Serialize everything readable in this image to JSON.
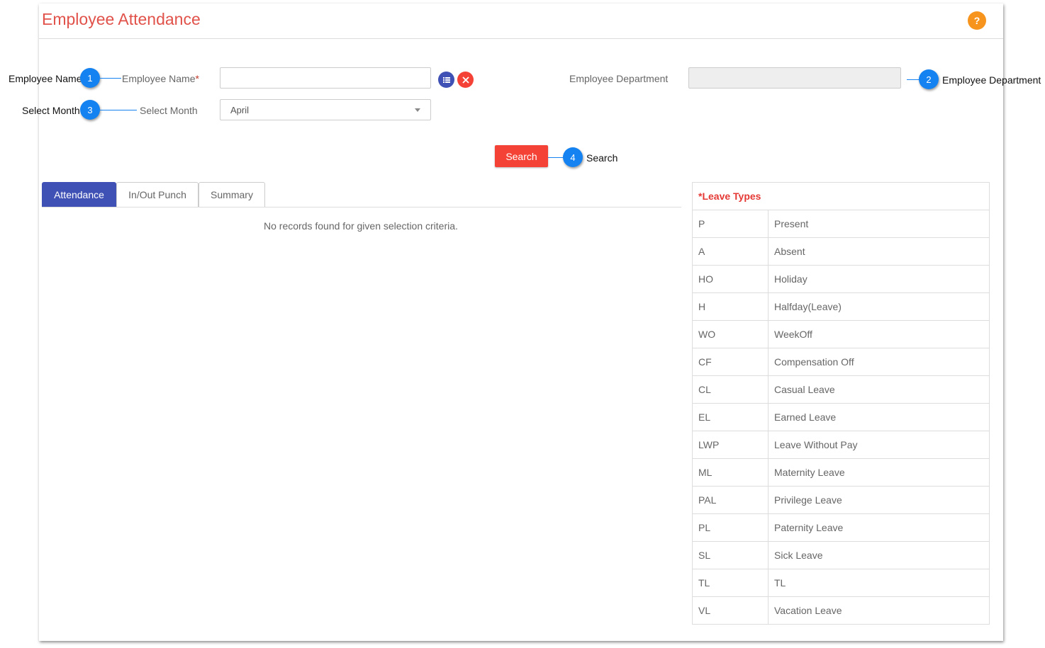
{
  "header": {
    "title": "Employee Attendance",
    "help_label": "?"
  },
  "form": {
    "employee_name_label": "Employee Name",
    "employee_name_required": "*",
    "employee_name_value": "",
    "employee_department_label": "Employee Department",
    "employee_department_value": "",
    "select_month_label": "Select Month",
    "select_month_value": "April",
    "search_label": "Search"
  },
  "tabs": [
    {
      "label": "Attendance",
      "active": true
    },
    {
      "label": "In/Out Punch",
      "active": false
    },
    {
      "label": "Summary",
      "active": false
    }
  ],
  "attendance": {
    "empty_message": "No records found for given selection criteria."
  },
  "leave_types": {
    "title": "*Leave Types",
    "rows": [
      {
        "code": "P",
        "name": "Present"
      },
      {
        "code": "A",
        "name": "Absent"
      },
      {
        "code": "HO",
        "name": "Holiday"
      },
      {
        "code": "H",
        "name": "Halfday(Leave)"
      },
      {
        "code": "WO",
        "name": "WeekOff"
      },
      {
        "code": "CF",
        "name": "Compensation Off"
      },
      {
        "code": "CL",
        "name": "Casual Leave"
      },
      {
        "code": "EL",
        "name": "Earned Leave"
      },
      {
        "code": "LWP",
        "name": "Leave Without Pay"
      },
      {
        "code": "ML",
        "name": "Maternity Leave"
      },
      {
        "code": "PAL",
        "name": "Privilege Leave"
      },
      {
        "code": "PL",
        "name": "Paternity Leave"
      },
      {
        "code": "SL",
        "name": "Sick Leave"
      },
      {
        "code": "TL",
        "name": "TL"
      },
      {
        "code": "VL",
        "name": "Vacation Leave"
      }
    ]
  },
  "callouts": [
    {
      "number": "1",
      "text": "Employee Name"
    },
    {
      "number": "2",
      "text": "Employee Department"
    },
    {
      "number": "3",
      "text": "Select Month"
    },
    {
      "number": "4",
      "text": "Search"
    }
  ],
  "icons": {
    "list_button": "list-icon",
    "clear_button": "close-icon",
    "month_dropdown": "caret-down-icon"
  },
  "colors": {
    "title": "#e0524a",
    "primary": "#3f51b5",
    "danger": "#f44336",
    "help": "#f7941d",
    "callout": "#1482f0"
  }
}
